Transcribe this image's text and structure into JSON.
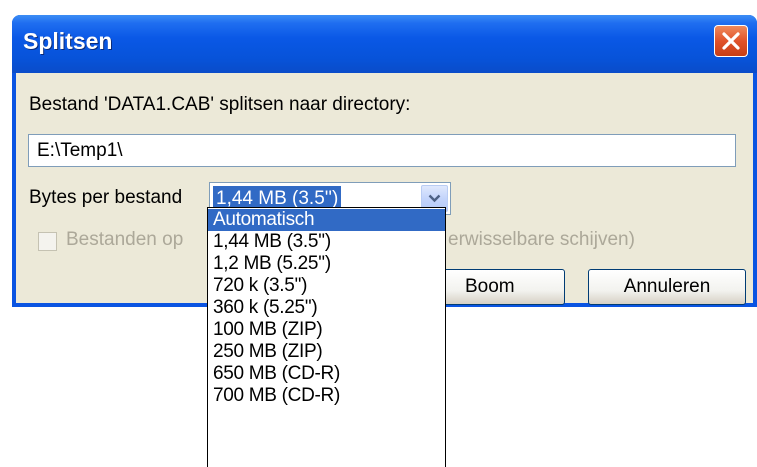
{
  "dialog": {
    "title": "Splitsen",
    "message": "Bestand 'DATA1.CAB' splitsen naar directory:",
    "directory_value": "E:\\Temp1\\",
    "bytes_label": "Bytes per bestand",
    "bytes_selected": "1,44 MB (3.5'')",
    "checkbox_label_left": "Bestanden op",
    "checkbox_label_right": "erwisselbare schijven)",
    "checkbox_checked": false,
    "checkbox_enabled": false,
    "buttons": {
      "tree": "Boom",
      "cancel": "Annuleren"
    }
  },
  "dropdown": {
    "options": [
      "Automatisch",
      "1,44 MB (3.5'')",
      "1,2 MB (5.25'')",
      "720 k (3.5'')",
      "360 k (5.25'')",
      "100 MB (ZIP)",
      "250 MB (ZIP)",
      "650 MB (CD-R)",
      "700 MB (CD-R)"
    ],
    "highlighted_index": 0
  },
  "colors": {
    "titlebar": "#0a58e6",
    "selection": "#316ac5",
    "dialog_face": "#ece9d8",
    "close_button": "#e0522a"
  },
  "icons": {
    "close": "close-x-icon",
    "dropdown": "chevron-down-icon"
  }
}
